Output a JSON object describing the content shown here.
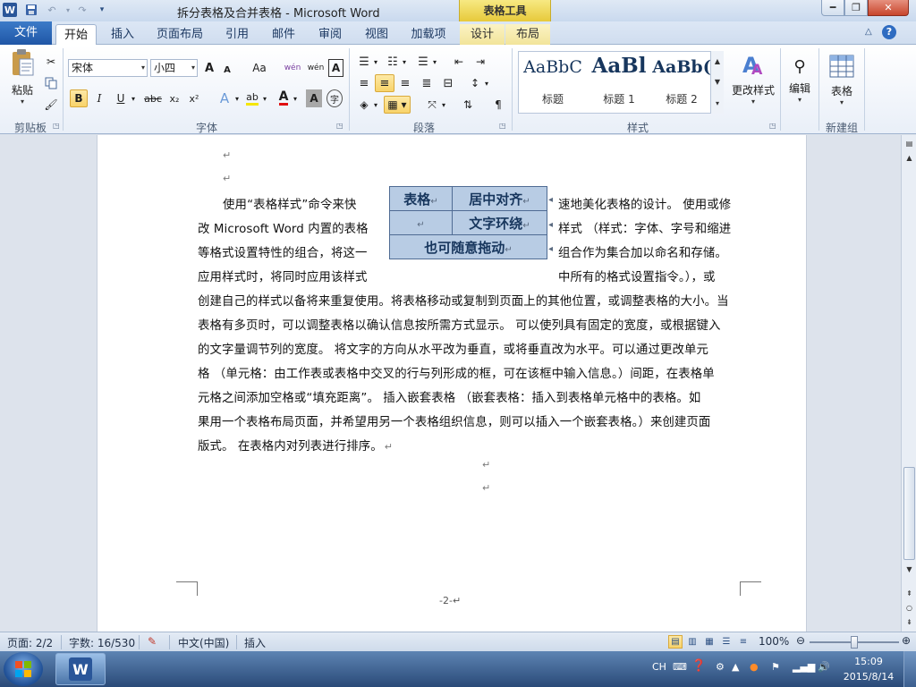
{
  "window": {
    "title": "拆分表格及合并表格 - Microsoft Word",
    "context_tab_header": "表格工具",
    "app_icon": "W",
    "min_glyph": "━",
    "max_glyph": "❐",
    "close_glyph": "✕"
  },
  "tabs": {
    "file": "文件",
    "items": [
      {
        "label": "开始"
      },
      {
        "label": "插入"
      },
      {
        "label": "页面布局"
      },
      {
        "label": "引用"
      },
      {
        "label": "邮件"
      },
      {
        "label": "审阅"
      },
      {
        "label": "视图"
      },
      {
        "label": "加载项"
      },
      {
        "label": "设计"
      },
      {
        "label": "布局"
      }
    ],
    "help": "?"
  },
  "ribbon": {
    "clipboard": {
      "group_label": "剪贴板",
      "paste_label": "粘贴"
    },
    "font": {
      "group_label": "字体",
      "font_name": "宋体",
      "font_size": "小四",
      "grow": "A",
      "shrink": "A",
      "change_case": "Aa",
      "bold": "B",
      "italic": "I",
      "underline": "U",
      "strike": "abc",
      "subscript": "x₂",
      "superscript": "x²",
      "clear_format": "wén",
      "phonetic": "wén",
      "char_border": "A",
      "char_shading": "A",
      "enclose": "字"
    },
    "paragraph": {
      "group_label": "段落"
    },
    "styles": {
      "group_label": "样式",
      "items": [
        {
          "preview": "AaBbC",
          "name": "标题"
        },
        {
          "preview": "AaBl",
          "name": "标题 1"
        },
        {
          "preview": "AaBb(",
          "name": "标题 2"
        }
      ],
      "change_styles": "更改样式"
    },
    "editing": {
      "label": "编辑"
    },
    "new_group": {
      "group_label": "新建组",
      "table_label": "表格"
    }
  },
  "document": {
    "lines": [
      "使用“表格样式”命令来快",
      "改 Microsoft Word 内置的表格",
      "等格式设置特性的组合，将这一",
      "应用样式时，将同时应用该样式",
      "创建自己的样式以备将来重复使用。将表格移动或复制到页面上的其他位置，或调整表格的大小。当",
      "表格有多页时，可以调整表格以确认信息按所需方式显示。  可以使列具有固定的宽度，或根据键入",
      "的文字量调节列的宽度。  将文字的方向从水平改为垂直，或将垂直改为水平。可以通过更改单元",
      "格 （单元格：由工作表或表格中交叉的行与列形成的框，可在该框中输入信息。）间距，在表格单",
      "元格之间添加空格或“填充距离”。 插入嵌套表格 （嵌套表格：插入到表格单元格中的表格。如",
      "果用一个表格布局页面，并希望用另一个表格组织信息，则可以插入一个嵌套表格。）来创建页面",
      "版式。 在表格内对列表进行排序。"
    ],
    "right_fragments": [
      "速地美化表格的设计。 使用或修",
      "样式 （样式：字体、字号和缩进",
      "组合作为集合加以命名和存储。",
      "中所有的格式设置指令。），或"
    ],
    "table": {
      "r1c1": "表格",
      "r1c2": "居中对齐",
      "r2c2": "文字环绕",
      "r3": "也可随意拖动"
    },
    "para_mark": "↵",
    "page_number": "-2-"
  },
  "status": {
    "page": "页面: 2/2",
    "words": "字数: 16/530",
    "language": "中文(中国)",
    "mode": "插入",
    "zoom": "100%",
    "zoom_level": 0.5
  },
  "taskbar": {
    "ime": "CH",
    "time": "15:09",
    "date": "2015/8/14"
  }
}
